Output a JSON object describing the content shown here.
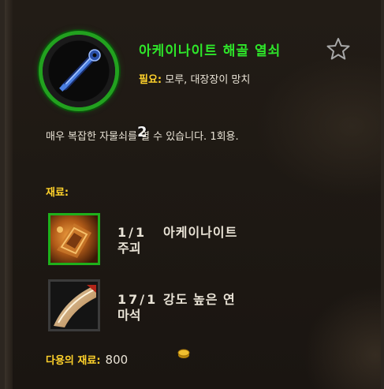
{
  "item": {
    "name": "아케이나이트 해골 열쇠",
    "count": "2",
    "requirement_label": "필요:",
    "requirement_value": "모루, 대장장이 망치",
    "description": "매우 복잡한 자물쇠를 열 수 있습니다. 1회용."
  },
  "materials": {
    "title": "재료:",
    "items": [
      {
        "qty": "1/1",
        "name_line1": "아케이나이트",
        "name_line2": "주괴"
      },
      {
        "qty": "17/1",
        "name_line1": "강도 높은 연",
        "name_line2": "마석"
      }
    ]
  },
  "reuse": {
    "label": "다용의 재료:",
    "value": "800"
  },
  "colors": {
    "item_name": "#2ee62a",
    "label_gold": "#ffd22b",
    "text": "#e9e3d6",
    "ring_green": "#22a11f"
  },
  "icons": [
    "skeleton-key-icon",
    "favorite-star-icon",
    "arcanite-bar-icon",
    "whetstone-icon",
    "coin-icon"
  ]
}
